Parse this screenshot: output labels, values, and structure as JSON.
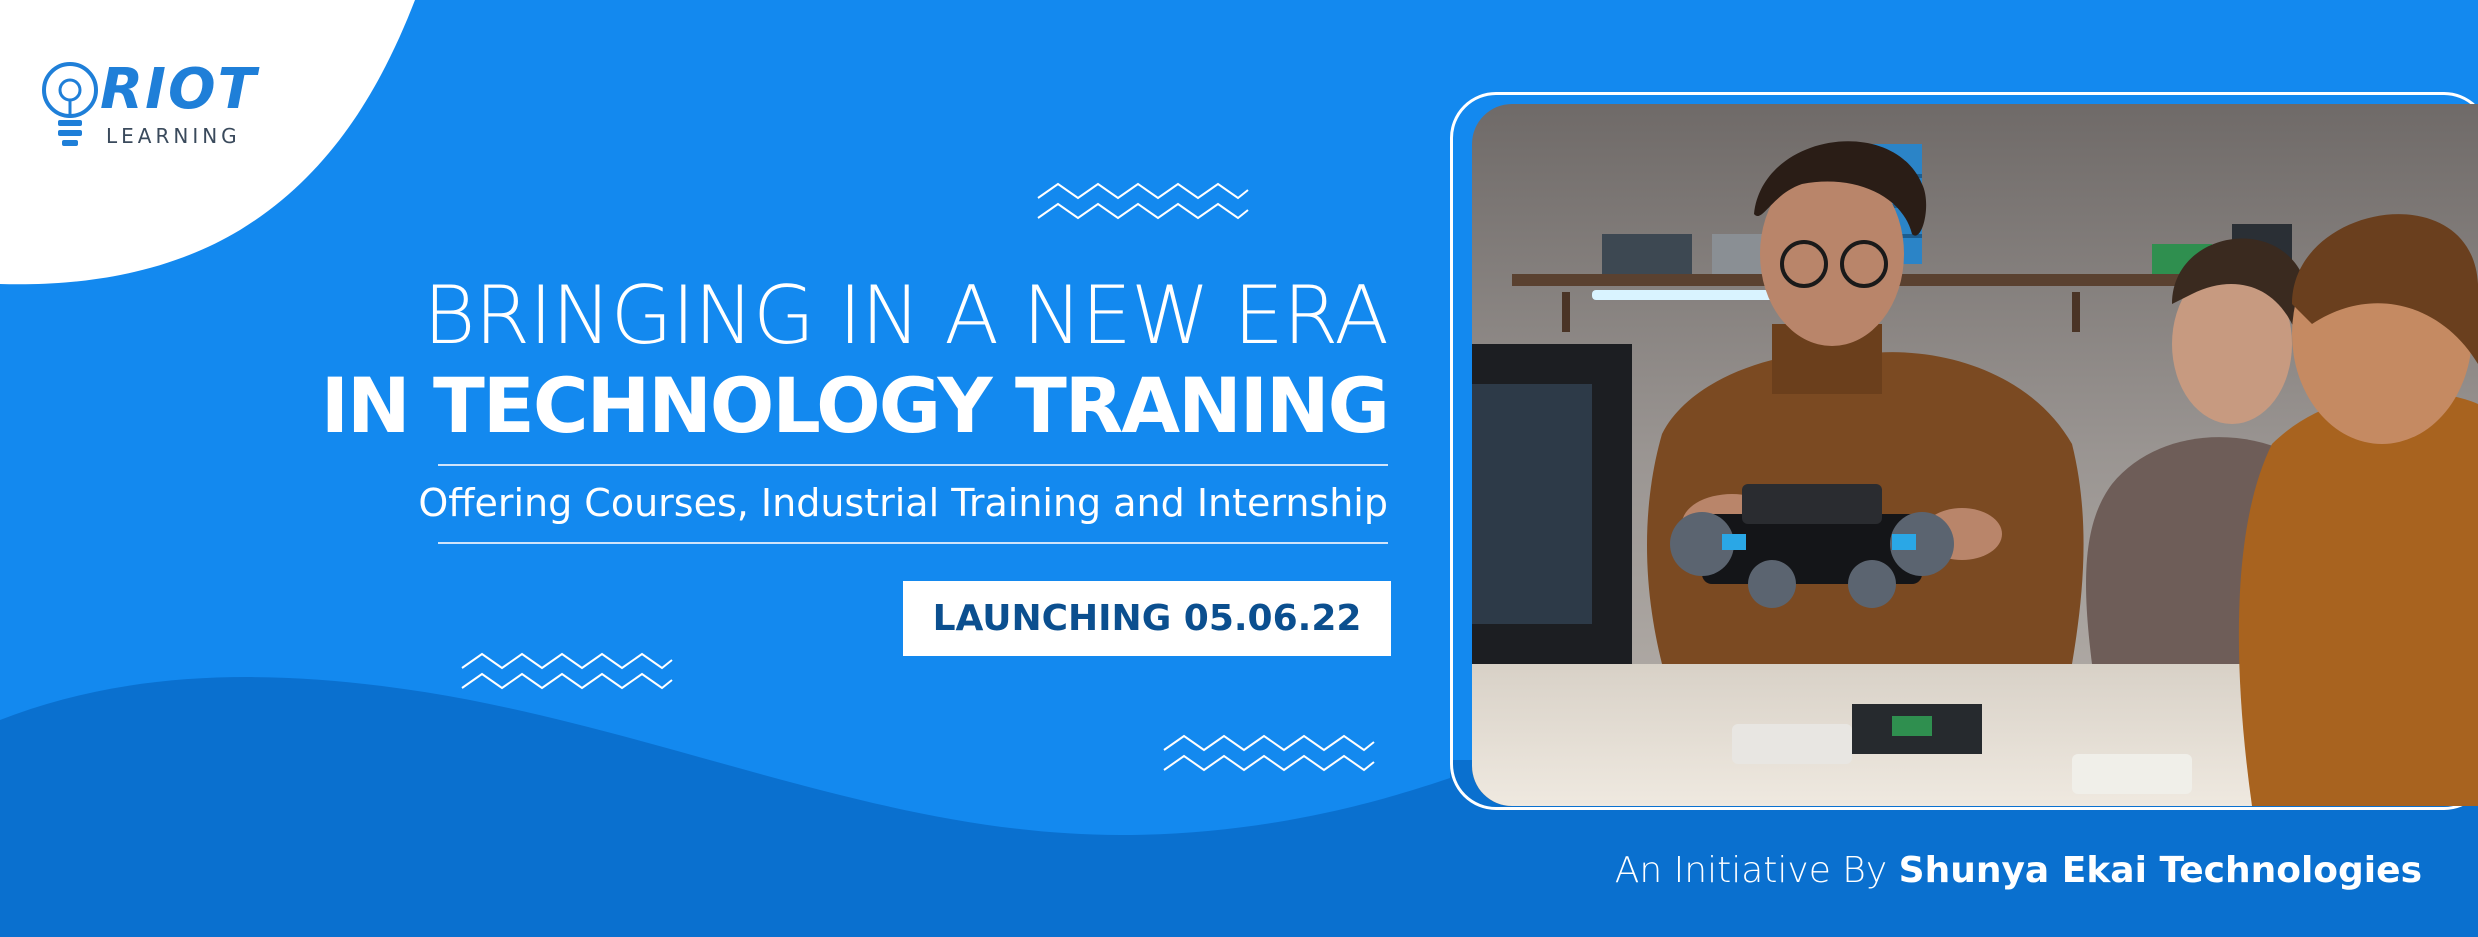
{
  "brand": {
    "name": "RIOT",
    "sub": "LEARNING"
  },
  "hero": {
    "line1": "BRINGING IN A NEW ERA",
    "line2": "IN TECHNOLOGY TRANING",
    "subtitle": "Offering Courses, Industrial Training and Internship",
    "launch": "LAUNCHING 05.06.22"
  },
  "footer": {
    "prefix": "An Initiative By",
    "company": "Shunya Ekai Technologies"
  },
  "icons": {
    "logo": "lightbulb-icon",
    "decoration": "zigzag-icon"
  },
  "colors": {
    "primary_blue": "#1389ef",
    "dark_blue": "#0a6fcf",
    "white": "#ffffff",
    "launch_text": "#0b4f8f"
  }
}
